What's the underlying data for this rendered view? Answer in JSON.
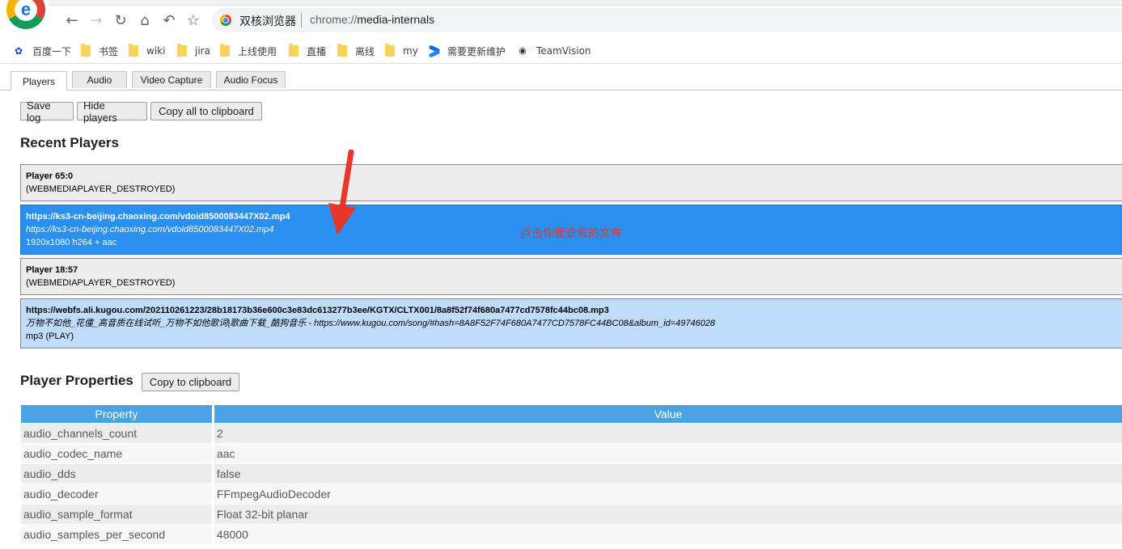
{
  "browser": {
    "name": "双核浏览器",
    "url_scheme": "chrome://",
    "url_host": "media-internals",
    "bookmarks": [
      "百度一下",
      "书签",
      "wiki",
      "jira",
      "上线使用",
      "直播",
      "离线",
      "my",
      "需要更新维护",
      "TeamVision"
    ]
  },
  "tabs": [
    "Players",
    "Audio",
    "Video Capture",
    "Audio Focus"
  ],
  "buttons": {
    "save_log": "Save log",
    "hide_players": "Hide players",
    "copy_all": "Copy all to clipboard",
    "copy_props": "Copy to clipboard"
  },
  "recent_players": {
    "heading": "Recent Players",
    "items": [
      {
        "title": "Player 65:0",
        "subtitle": "",
        "status": "(WEBMEDIAPLAYER_DESTROYED)"
      },
      {
        "title": "https://ks3-cn-beijing.chaoxing.com/vdoid8500083447X02.mp4",
        "subtitle": "https://ks3-cn-beijing.chaoxing.com/vdoid8500083447X02.mp4",
        "status": "1920x1080 h264 + aac"
      },
      {
        "title": "Player 18:57",
        "subtitle": "",
        "status": "(WEBMEDIAPLAYER_DESTROYED)"
      },
      {
        "title": "https://webfs.ali.kugou.com/202110261223/28b18173b36e600c3e83dc613277b3ee/KGTX/CLTX001/8a8f52f74f680a7477cd7578fc44bc08.mp3",
        "subtitle": "万物不如他_花僮_高音质在线试听_万物不如他歌词|歌曲下载_酷狗音乐 - https://www.kugou.com/song/#hash=8A8F52F74F680A7477CD7578FC44BC08&album_id=49746028",
        "status": "mp3 (PLAY)"
      }
    ]
  },
  "annotation": "点击你要查看的文件",
  "player_properties": {
    "heading": "Player Properties",
    "columns": [
      "Property",
      "Value"
    ],
    "rows": [
      [
        "audio_channels_count",
        "2"
      ],
      [
        "audio_codec_name",
        "aac"
      ],
      [
        "audio_dds",
        "false"
      ],
      [
        "audio_decoder",
        "FFmpegAudioDecoder"
      ],
      [
        "audio_sample_format",
        "Float 32-bit planar"
      ],
      [
        "audio_samples_per_second",
        "48000"
      ]
    ]
  },
  "colors": {
    "selected_player": "#2a8fef",
    "playing_player": "#bfdcfb",
    "table_header": "#4aa3e3",
    "annotation": "#e8362b"
  }
}
